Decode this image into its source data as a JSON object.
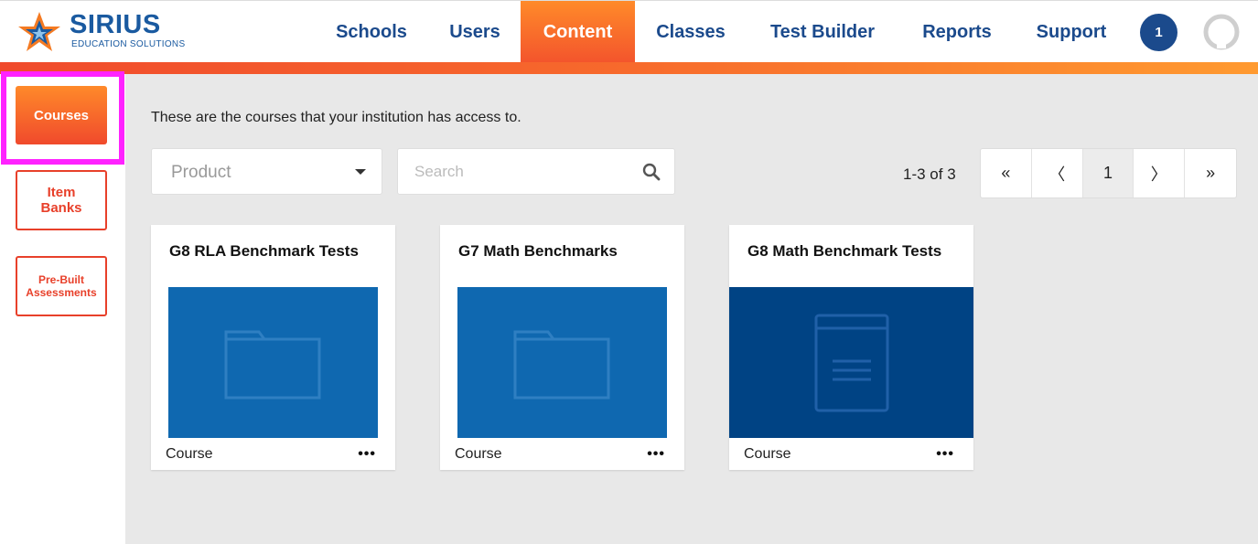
{
  "brand": {
    "name": "SIRIUS",
    "tagline": "EDUCATION SOLUTIONS",
    "primary_color": "#1b4a8c",
    "accent_color": "#f3542c"
  },
  "nav": {
    "items": [
      {
        "label": "Schools"
      },
      {
        "label": "Users"
      },
      {
        "label": "Content",
        "active": true
      },
      {
        "label": "Classes"
      },
      {
        "label": "Test Builder"
      },
      {
        "label": "Reports"
      },
      {
        "label": "Support"
      }
    ],
    "notification_count": "1",
    "avatar_icon": "user-avatar-icon"
  },
  "sidebar": {
    "items": [
      {
        "label": "Courses",
        "active": true
      },
      {
        "label": "Item Banks"
      },
      {
        "label": "Pre-Built Assessments"
      }
    ]
  },
  "main": {
    "intro": "These are the courses that your institution has access to.",
    "filter": {
      "placeholder": "Product"
    },
    "search": {
      "placeholder": "Search"
    },
    "pagination": {
      "range": "1-3 of 3",
      "first": "«",
      "prev": "〈",
      "current": "1",
      "next": "〉",
      "last": "»"
    },
    "courses": [
      {
        "title": "G8 RLA Benchmark Tests",
        "type": "Course",
        "menu": "•••",
        "thumb_icon": "folder-icon"
      },
      {
        "title": "G7 Math Benchmarks",
        "type": "Course",
        "menu": "•••",
        "thumb_icon": "folder-icon"
      },
      {
        "title": "G8 Math Benchmark Tests",
        "type": "Course",
        "menu": "•••",
        "thumb_icon": "book-icon"
      }
    ]
  }
}
